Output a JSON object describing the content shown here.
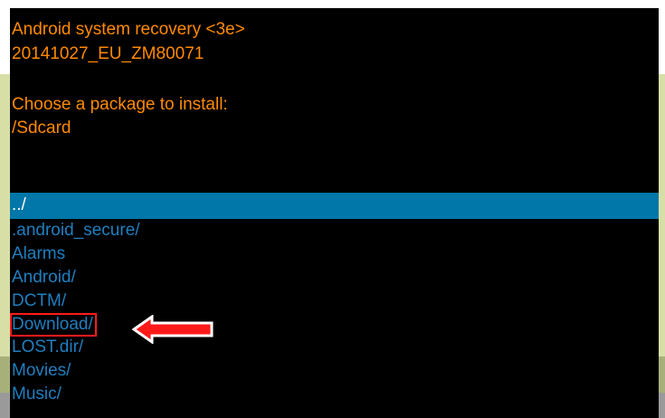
{
  "colors": {
    "header_text": "#ff8a00",
    "list_text": "#1f7fc0",
    "selected_row_bg": "#0077a8",
    "selected_row_text": "#ffffff",
    "screen_bg": "#000000",
    "annotation": "#ff1a1a"
  },
  "header": {
    "title": "Android system recovery <3e>",
    "build": "20141027_EU_ZM80071",
    "prompt": "Choose a package to install:",
    "path": "/Sdcard"
  },
  "file_list": {
    "items": [
      {
        "label": "../",
        "selected": true
      },
      {
        "label": ".android_secure/",
        "selected": false
      },
      {
        "label": "Alarms",
        "selected": false
      },
      {
        "label": "Android/",
        "selected": false
      },
      {
        "label": "DCTM/",
        "selected": false
      },
      {
        "label": "Download/",
        "selected": false,
        "highlighted": true
      },
      {
        "label": "LOST.dir/",
        "selected": false
      },
      {
        "label": "Movies/",
        "selected": false
      },
      {
        "label": "Music/",
        "selected": false
      }
    ]
  },
  "annotation": {
    "icon": "left-arrow-icon"
  }
}
